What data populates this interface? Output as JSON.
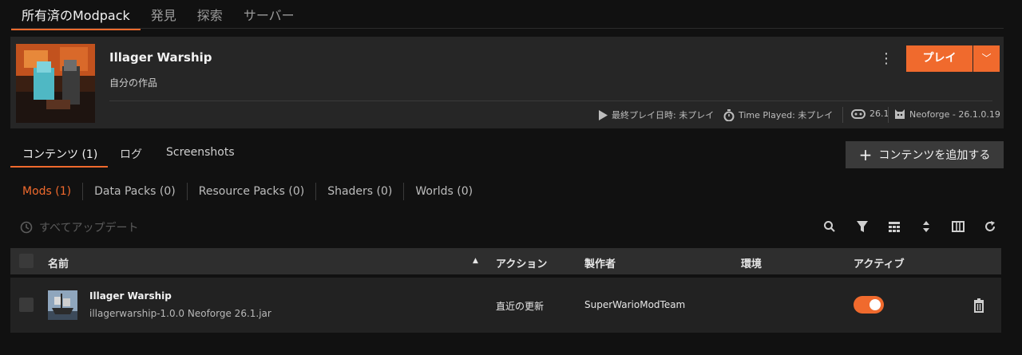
{
  "top_tabs": [
    "所有済のModpack",
    "発見",
    "探索",
    "サーバー"
  ],
  "pack": {
    "title": "Illager Warship",
    "subtitle": "自分の作品",
    "more_icon": "kebab-icon",
    "play_label": "プレイ",
    "last_played": "最終プレイ日時: 未プレイ",
    "time_played": "Time Played: 未プレイ",
    "game_version": "26.1",
    "loader": "Neoforge - 26.1.0.19"
  },
  "content_tabs": [
    "コンテンツ (1)",
    "ログ",
    "Screenshots"
  ],
  "add_content_label": "コンテンツを追加する",
  "filters": [
    "Mods (1)",
    "Data Packs (0)",
    "Resource Packs (0)",
    "Shaders (0)",
    "Worlds (0)"
  ],
  "update_all_label": "すべてアップデート",
  "tools": [
    "search-icon",
    "filter-icon",
    "grid-icon",
    "sort-icon",
    "columns-icon",
    "refresh-icon"
  ],
  "table": {
    "headers": {
      "name": "名前",
      "action": "アクション",
      "author": "製作者",
      "env": "環境",
      "active": "アクティブ"
    },
    "rows": [
      {
        "name": "Illager Warship",
        "file": "illagerwarship-1.0.0 Neoforge 26.1.jar",
        "action": "直近の更新",
        "author": "SuperWarioModTeam",
        "env": "",
        "active": true
      }
    ]
  },
  "colors": {
    "accent": "#f06a2d",
    "bg": "#111111",
    "card": "#262626"
  }
}
